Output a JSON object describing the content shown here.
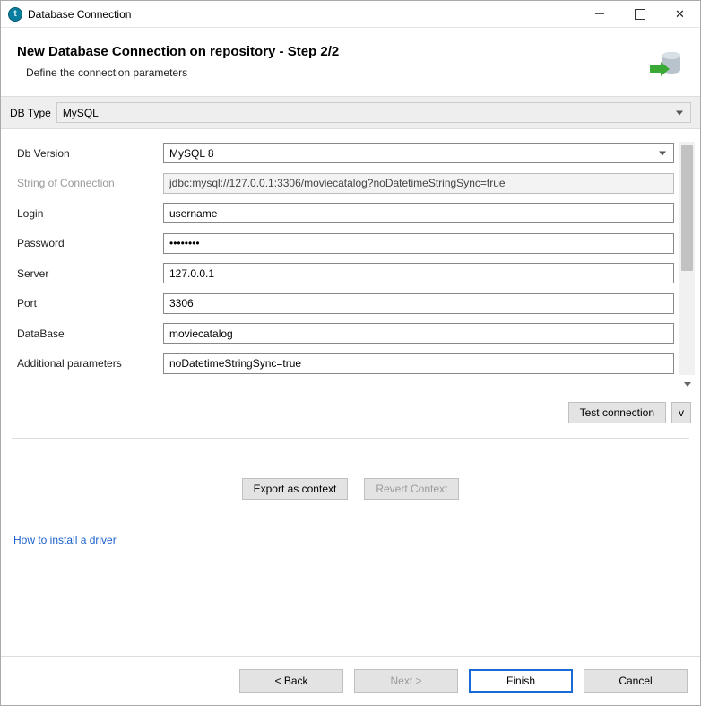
{
  "titlebar": {
    "title": "Database Connection"
  },
  "header": {
    "title": "New Database Connection on repository - Step 2/2",
    "subtitle": "Define the connection parameters"
  },
  "dbtype": {
    "label": "DB Type",
    "value": "MySQL"
  },
  "fields": {
    "db_version": {
      "label": "Db Version",
      "value": "MySQL 8"
    },
    "conn_string": {
      "label": "String of Connection",
      "value": "jdbc:mysql://127.0.0.1:3306/moviecatalog?noDatetimeStringSync=true"
    },
    "login": {
      "label": "Login",
      "value": "username"
    },
    "password": {
      "label": "Password",
      "value": "••••••••"
    },
    "server": {
      "label": "Server",
      "value": "127.0.0.1"
    },
    "port": {
      "label": "Port",
      "value": "3306"
    },
    "database": {
      "label": "DataBase",
      "value": "moviecatalog"
    },
    "additional": {
      "label": "Additional parameters",
      "value": "noDatetimeStringSync=true"
    }
  },
  "buttons": {
    "test_connection": "Test connection",
    "test_menu": "v",
    "export_context": "Export as context",
    "revert_context": "Revert Context",
    "back": "< Back",
    "next": "Next >",
    "finish": "Finish",
    "cancel": "Cancel"
  },
  "link": {
    "install_driver": "How to install a driver"
  }
}
